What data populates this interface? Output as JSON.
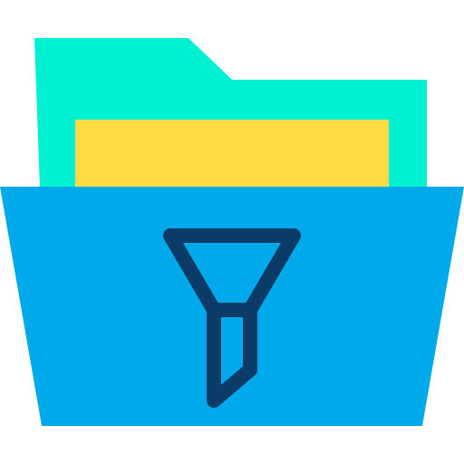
{
  "icon": {
    "name": "folder-filter-icon",
    "colors": {
      "background": "#ffffff",
      "folder_back": "#00F0D2",
      "paper": "#FFDB44",
      "folder_front": "#00AAEA",
      "filter_stroke": "#0B3B67"
    }
  }
}
